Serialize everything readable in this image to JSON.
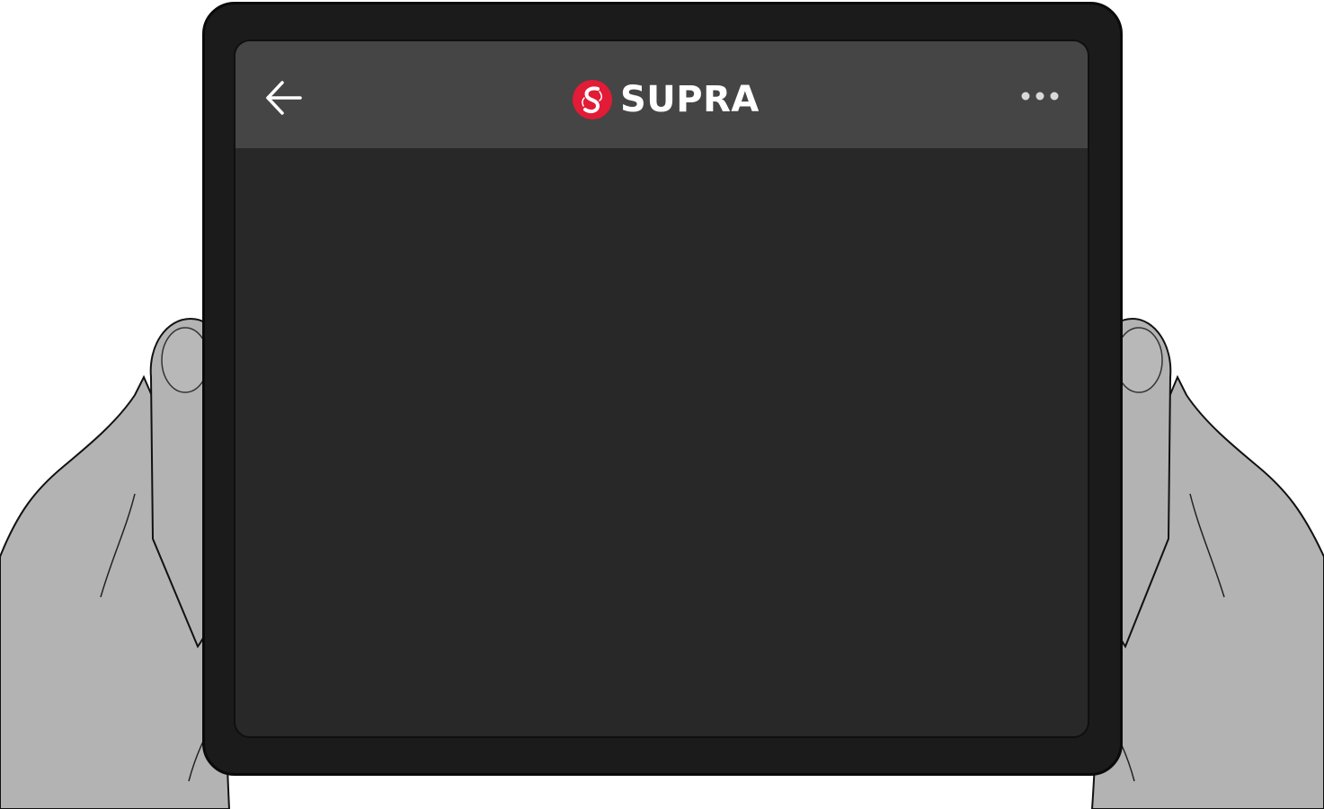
{
  "app": {
    "brand_name": "SUPRA",
    "brand_color": "#e21b37"
  },
  "appbar": {
    "background": "#454545",
    "back_icon": "arrow-left-icon",
    "more_icon": "more-horizontal-icon"
  },
  "screen": {
    "background": "#282828"
  }
}
